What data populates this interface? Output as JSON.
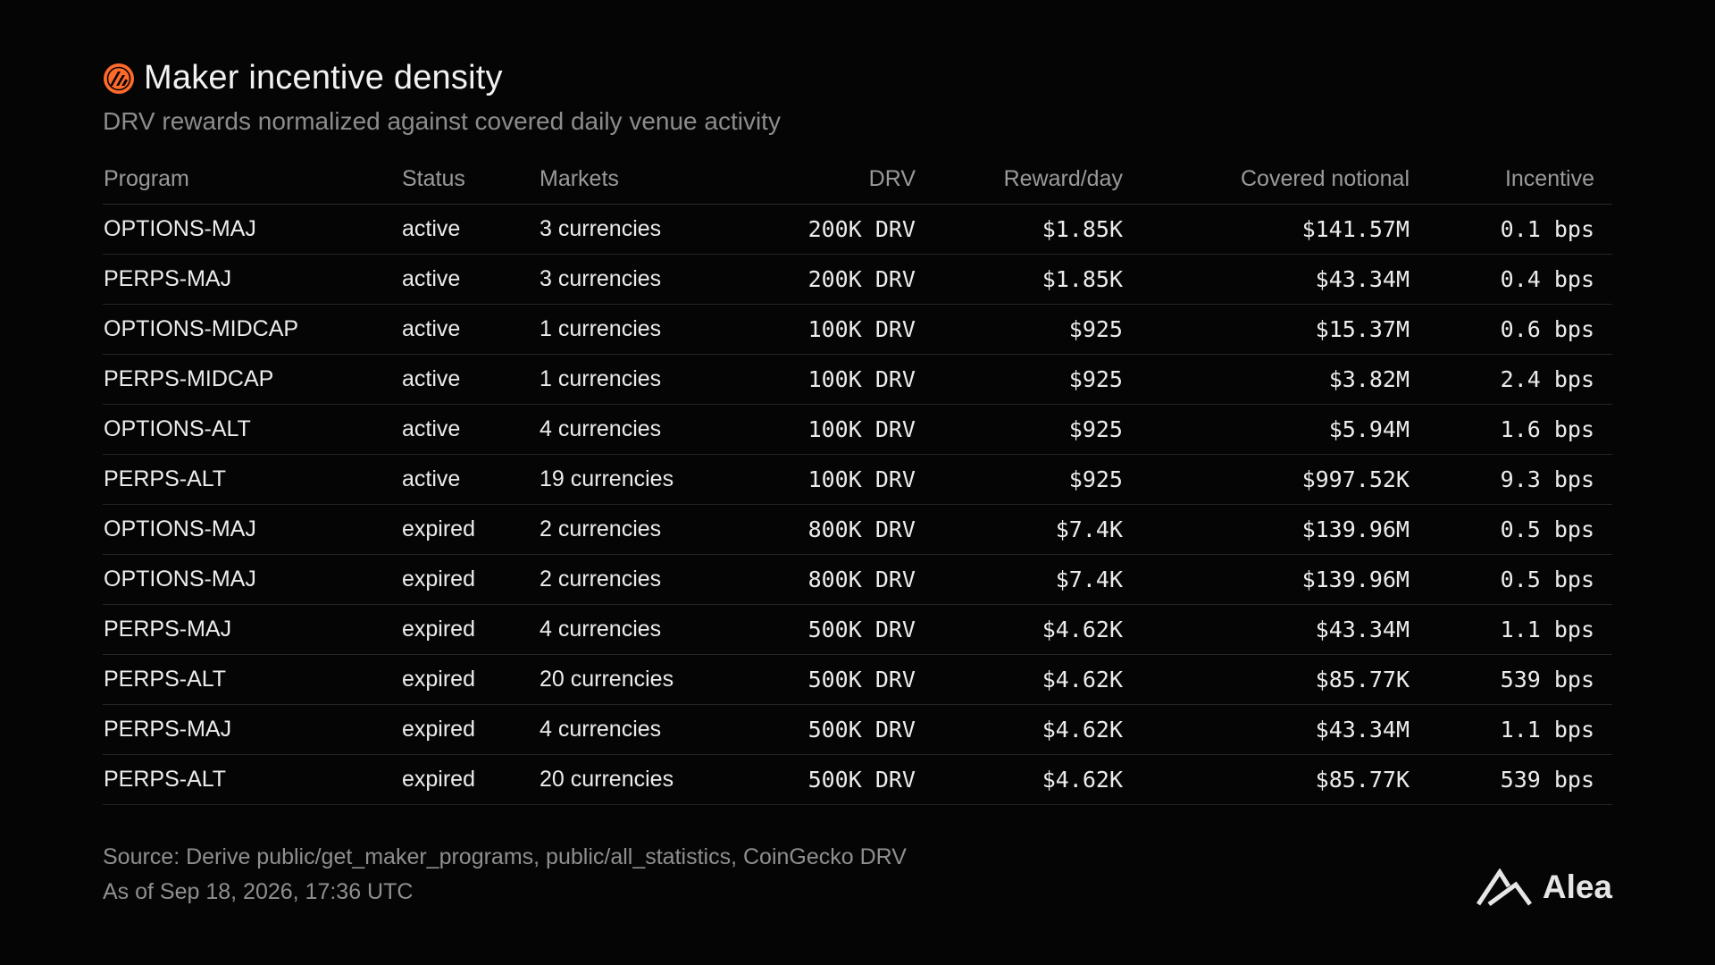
{
  "header": {
    "title": "Maker incentive density",
    "subtitle": "DRV rewards normalized against covered daily venue activity",
    "logo_icon": "drv-logo-icon",
    "accent_color": "#ff6a2b"
  },
  "table": {
    "columns": [
      "Program",
      "Status",
      "Markets",
      "DRV",
      "Reward/day",
      "Covered notional",
      "Incentive"
    ],
    "rows": [
      {
        "program": "OPTIONS-MAJ",
        "status": "active",
        "markets": "3 currencies",
        "drv": "200K DRV",
        "reward": "$1.85K",
        "notional": "$141.57M",
        "incentive": "0.1 bps"
      },
      {
        "program": "PERPS-MAJ",
        "status": "active",
        "markets": "3 currencies",
        "drv": "200K DRV",
        "reward": "$1.85K",
        "notional": "$43.34M",
        "incentive": "0.4 bps"
      },
      {
        "program": "OPTIONS-MIDCAP",
        "status": "active",
        "markets": "1 currencies",
        "drv": "100K DRV",
        "reward": "$925",
        "notional": "$15.37M",
        "incentive": "0.6 bps"
      },
      {
        "program": "PERPS-MIDCAP",
        "status": "active",
        "markets": "1 currencies",
        "drv": "100K DRV",
        "reward": "$925",
        "notional": "$3.82M",
        "incentive": "2.4 bps"
      },
      {
        "program": "OPTIONS-ALT",
        "status": "active",
        "markets": "4 currencies",
        "drv": "100K DRV",
        "reward": "$925",
        "notional": "$5.94M",
        "incentive": "1.6 bps"
      },
      {
        "program": "PERPS-ALT",
        "status": "active",
        "markets": "19 currencies",
        "drv": "100K DRV",
        "reward": "$925",
        "notional": "$997.52K",
        "incentive": "9.3 bps"
      },
      {
        "program": "OPTIONS-MAJ",
        "status": "expired",
        "markets": "2 currencies",
        "drv": "800K DRV",
        "reward": "$7.4K",
        "notional": "$139.96M",
        "incentive": "0.5 bps"
      },
      {
        "program": "OPTIONS-MAJ",
        "status": "expired",
        "markets": "2 currencies",
        "drv": "800K DRV",
        "reward": "$7.4K",
        "notional": "$139.96M",
        "incentive": "0.5 bps"
      },
      {
        "program": "PERPS-MAJ",
        "status": "expired",
        "markets": "4 currencies",
        "drv": "500K DRV",
        "reward": "$4.62K",
        "notional": "$43.34M",
        "incentive": "1.1 bps"
      },
      {
        "program": "PERPS-ALT",
        "status": "expired",
        "markets": "20 currencies",
        "drv": "500K DRV",
        "reward": "$4.62K",
        "notional": "$85.77K",
        "incentive": "539 bps"
      },
      {
        "program": "PERPS-MAJ",
        "status": "expired",
        "markets": "4 currencies",
        "drv": "500K DRV",
        "reward": "$4.62K",
        "notional": "$43.34M",
        "incentive": "1.1 bps"
      },
      {
        "program": "PERPS-ALT",
        "status": "expired",
        "markets": "20 currencies",
        "drv": "500K DRV",
        "reward": "$4.62K",
        "notional": "$85.77K",
        "incentive": "539 bps"
      }
    ]
  },
  "footer": {
    "source": "Source: Derive public/get_maker_programs, public/all_statistics, CoinGecko DRV",
    "as_of": "As of Sep 18, 2026, 17:36 UTC"
  },
  "brand": {
    "name": "Alea",
    "icon": "alea-logo-icon"
  }
}
